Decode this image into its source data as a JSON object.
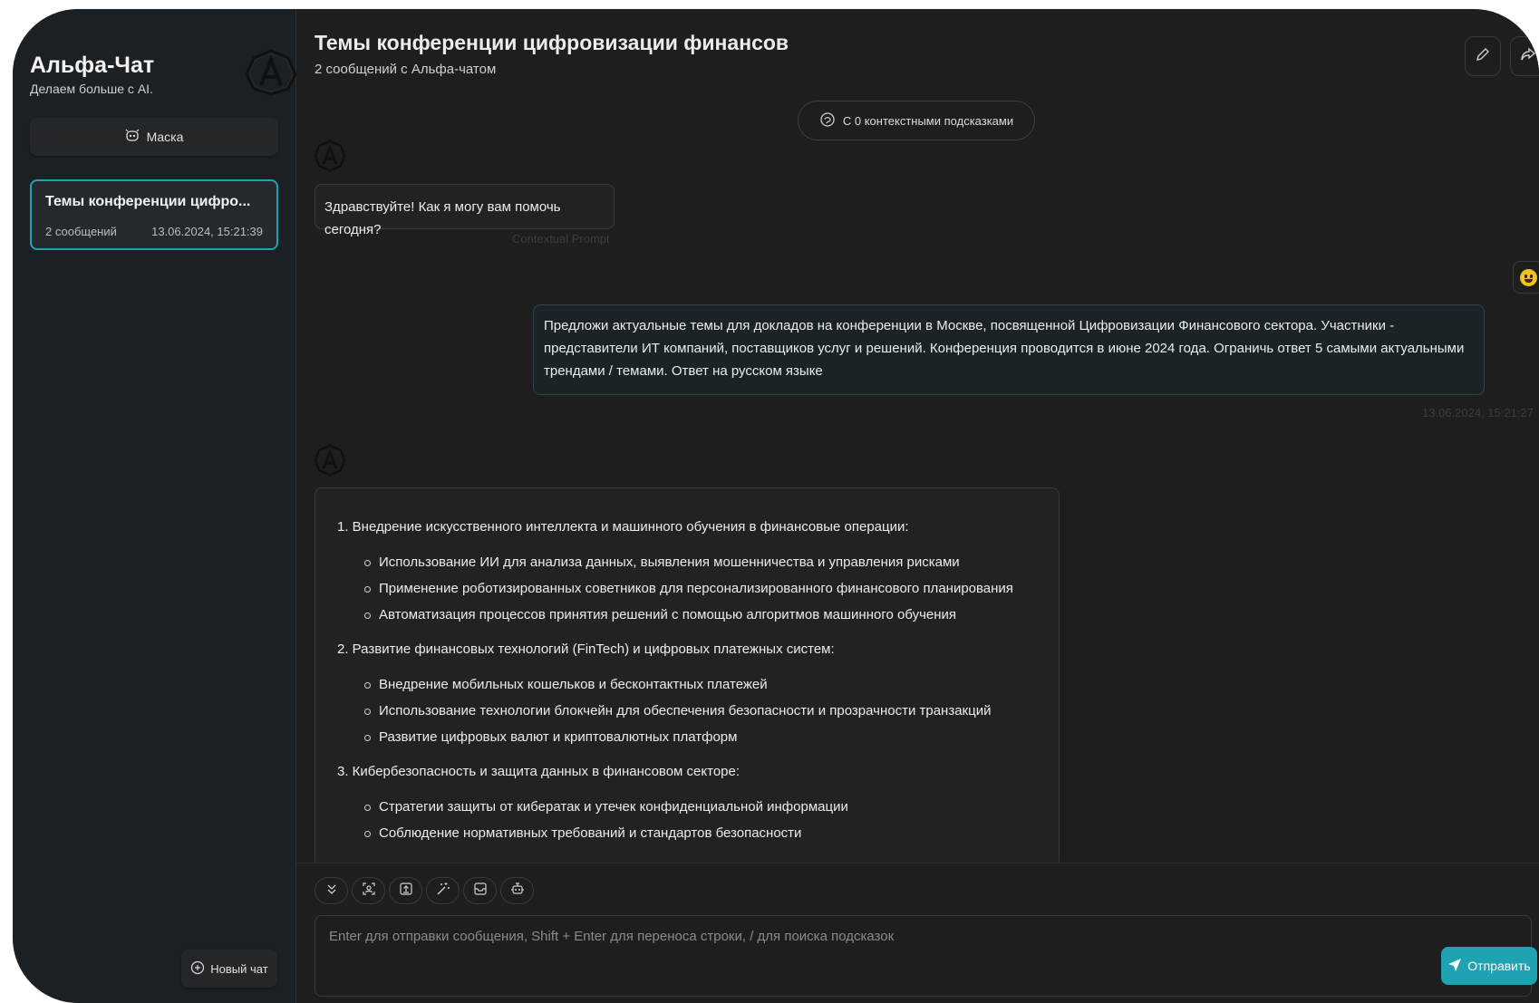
{
  "sidebar": {
    "brand_title": "Альфа-Чат",
    "brand_subtitle": "Делаем больше с AI.",
    "mask_label": "Маска",
    "chats": [
      {
        "title": "Темы конференции цифро...",
        "count": "2 сообщений",
        "time": "13.06.2024, 15:21:39"
      }
    ],
    "new_chat_label": "Новый чат"
  },
  "header": {
    "title": "Темы конференции цифровизации финансов",
    "subtitle": "2 сообщений с Альфа-чатом",
    "icons": [
      "edit-icon",
      "share-icon"
    ]
  },
  "context_pill": "С 0 контекстными подсказками",
  "messages": [
    {
      "role": "bot",
      "text": "Здравствуйте! Как я могу вам помочь сегодня?",
      "note": "Contextual Prompt"
    },
    {
      "role": "user",
      "text": "Предложи актуальные темы для докладов на конференции в Москве, посвященной Цифровизации Финансового сектора. Участники - представители ИТ компаний, поставщиков услуг и решений. Конференция проводится в июне 2024 года. Ограничь ответ 5 самыми актуальными трендами / темами. Ответ на русском языке",
      "time": "13.06.2024, 15:21:27"
    },
    {
      "role": "bot",
      "sections": [
        {
          "heading": "1. Внедрение искусственного интеллекта и машинного обучения в финансовые операции:",
          "bullets": [
            "Использование ИИ для анализа данных, выявления мошенничества и управления рисками",
            "Применение роботизированных советников для персонализированного финансового планирования",
            "Автоматизация процессов принятия решений с помощью алгоритмов машинного обучения"
          ]
        },
        {
          "heading": "2. Развитие финансовых технологий (FinTech) и цифровых платежных систем:",
          "bullets": [
            "Внедрение мобильных кошельков и бесконтактных платежей",
            "Использование технологии блокчейн для обеспечения безопасности и прозрачности транзакций",
            "Развитие цифровых валют и криптовалютных платформ"
          ]
        },
        {
          "heading": "3. Кибербезопасность и защита данных в финансовом секторе:",
          "bullets": [
            "Стратегии защиты от кибератак и утечек конфиденциальной информации",
            "Соблюдение нормативных требований и стандартов безопасности"
          ]
        }
      ]
    }
  ],
  "toolbar_icons": [
    "scroll-down-icon",
    "context-icon",
    "upload-icon",
    "magic-icon",
    "archive-icon",
    "robot-icon"
  ],
  "input": {
    "placeholder": "Enter для отправки сообщения, Shift + Enter для переноса строки, / для поиска подсказок",
    "send_label": "Отправить"
  },
  "colors": {
    "accent": "#1fa3b3",
    "background": "#1e1e1e",
    "sidebar": "#1b2024"
  }
}
